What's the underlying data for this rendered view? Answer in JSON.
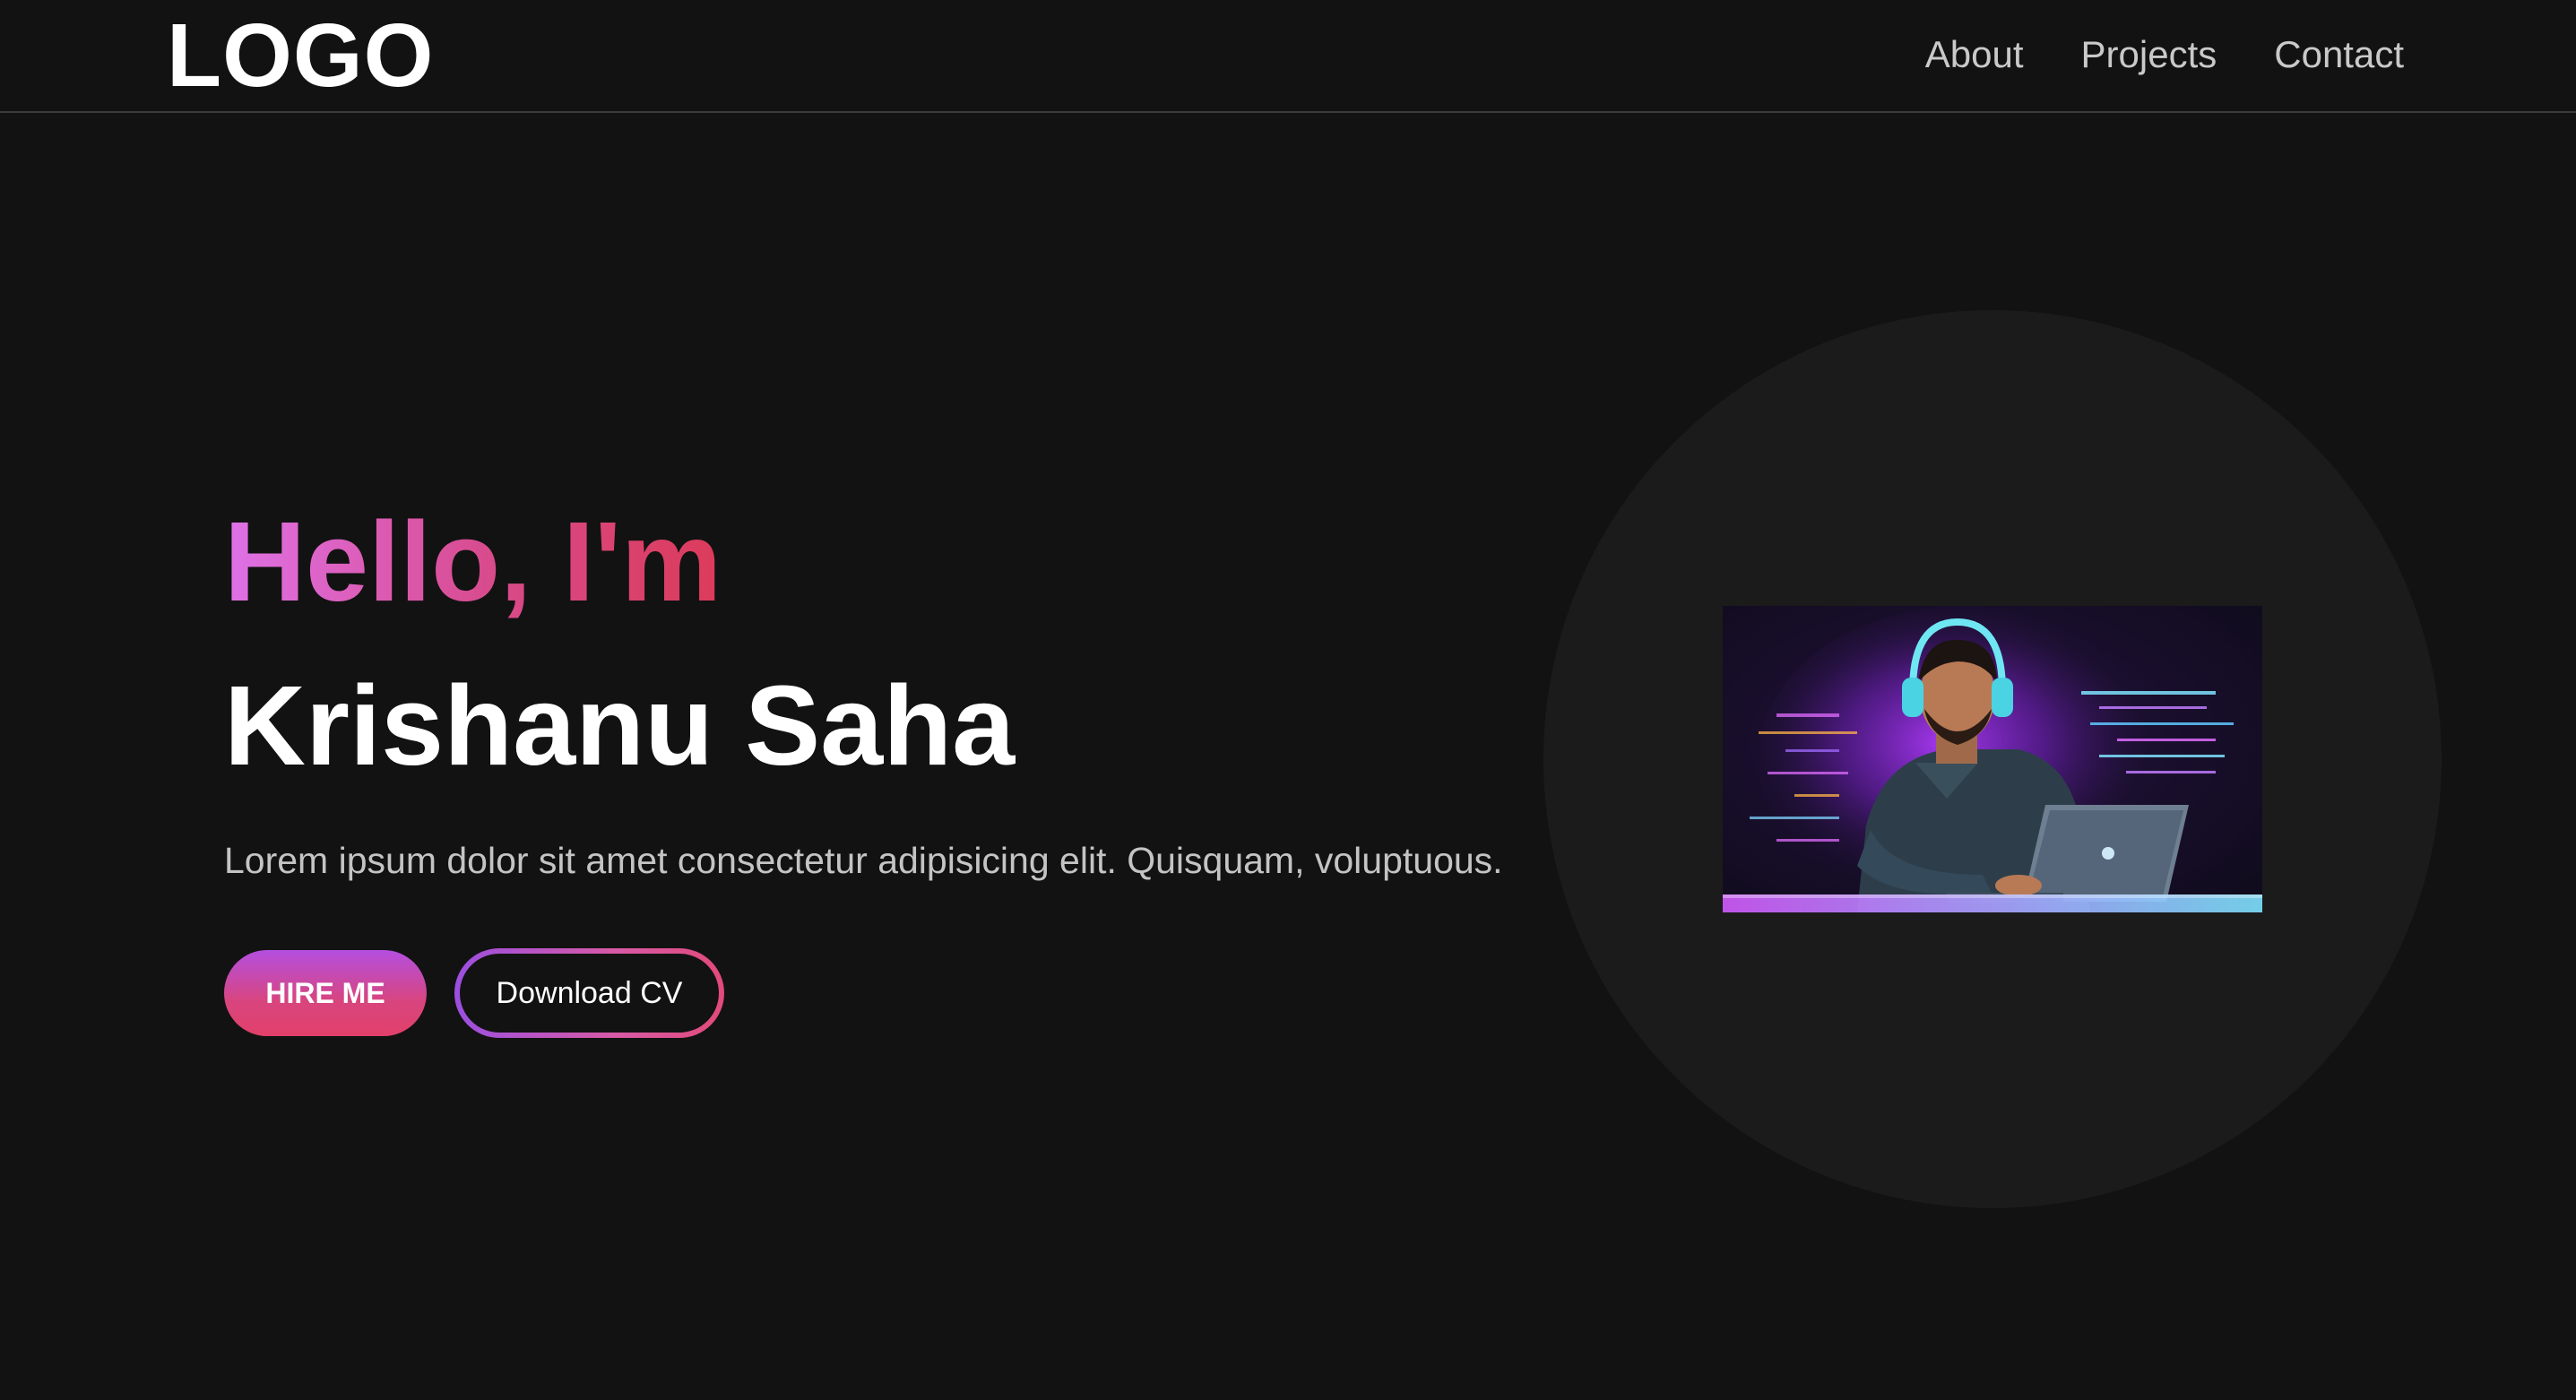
{
  "header": {
    "logo": "LOGO",
    "nav": [
      {
        "label": "About"
      },
      {
        "label": "Projects"
      },
      {
        "label": "Contact"
      }
    ]
  },
  "hero": {
    "greeting": "Hello, I'm",
    "name": "Krishanu Saha",
    "intro": "Lorem ipsum dolor sit amet consectetur adipisicing elit. Quisquam, voluptuous.",
    "hire_label": "HIRE ME",
    "cv_label": "Download CV",
    "image_icon": "developer-illustration-icon"
  },
  "colors": {
    "background": "#121212",
    "accent_pink": "#df72e8",
    "accent_red": "#dc3b5a",
    "accent_purple": "#9b4fe0",
    "circle": "#1b1b1b"
  }
}
